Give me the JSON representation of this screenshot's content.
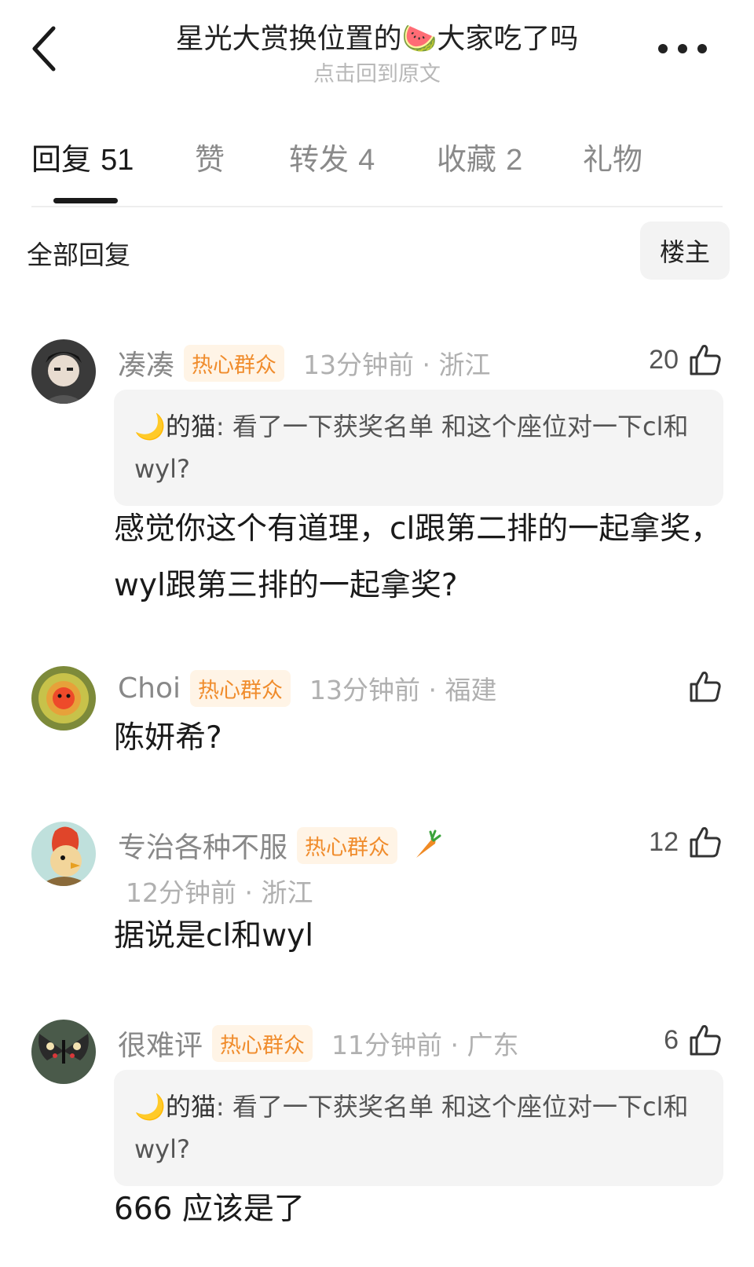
{
  "header": {
    "title": "星光大赏换位置的🍉大家吃了吗",
    "subtitle": "点击回到原文",
    "back_icon": "chevron-left-icon",
    "more_icon": "more-horizontal-icon"
  },
  "tabs": [
    {
      "label": "回复",
      "count": "51"
    },
    {
      "label": "赞",
      "count": ""
    },
    {
      "label": "转发",
      "count": "4"
    },
    {
      "label": "收藏",
      "count": "2"
    },
    {
      "label": "礼物",
      "count": ""
    }
  ],
  "filter": {
    "all_replies": "全部回复",
    "op_only": "楼主"
  },
  "colors": {
    "badge_bg": "#fff4e6",
    "badge_text": "#f08c2c",
    "quote_bg": "#f4f4f4"
  },
  "comments": [
    {
      "username": "凑凑",
      "badge": "热心群众",
      "time_location": "13分钟前 · 浙江",
      "likes": "20",
      "quote_author": "🌙的猫",
      "quote_text": ": 看了一下获奖名单 和这个座位对一下cl和wyl?",
      "body": "感觉你这个有道理，cl跟第二排的一起拿奖，wyl跟第三排的一起拿奖?"
    },
    {
      "username": "Choi",
      "badge": "热心群众",
      "time_location": "13分钟前 · 福建",
      "likes": "",
      "body": "陈妍希?"
    },
    {
      "username": "专治各种不服",
      "badge": "热心群众",
      "extra_badge_icon": "carrot-icon",
      "time_location": "12分钟前 · 浙江",
      "likes": "12",
      "body": "据说是cl和wyl"
    },
    {
      "username": "很难评",
      "badge": "热心群众",
      "time_location": "11分钟前 · 广东",
      "likes": "6",
      "quote_author": "🌙的猫",
      "quote_text": ": 看了一下获奖名单 和这个座位对一下cl和wyl?",
      "body": "666 应该是了"
    }
  ]
}
